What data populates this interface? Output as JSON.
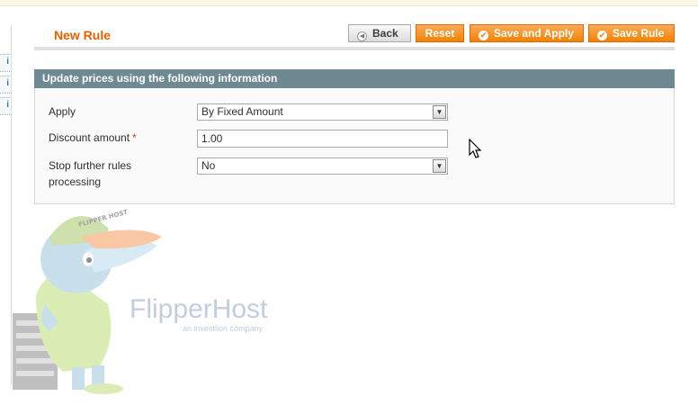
{
  "header": {
    "title": "New Rule",
    "buttons": {
      "back": "Back",
      "reset": "Reset",
      "save_apply": "Save and Apply",
      "save": "Save Rule"
    }
  },
  "section": {
    "title": "Update prices using the following information"
  },
  "form": {
    "apply": {
      "label": "Apply",
      "value": "By Fixed Amount"
    },
    "discount": {
      "label": "Discount amount",
      "required_mark": "*",
      "value": "1.00"
    },
    "stop": {
      "label_line1": "Stop further rules",
      "label_line2": "processing",
      "value": "No"
    }
  },
  "watermark": {
    "brand": "FlipperHost",
    "tagline": "an investlion company",
    "cap_text": "FLIPPER HOST"
  },
  "colors": {
    "accent": "#eb5e00",
    "button": "#f18200",
    "section_head": "#6f8992"
  }
}
